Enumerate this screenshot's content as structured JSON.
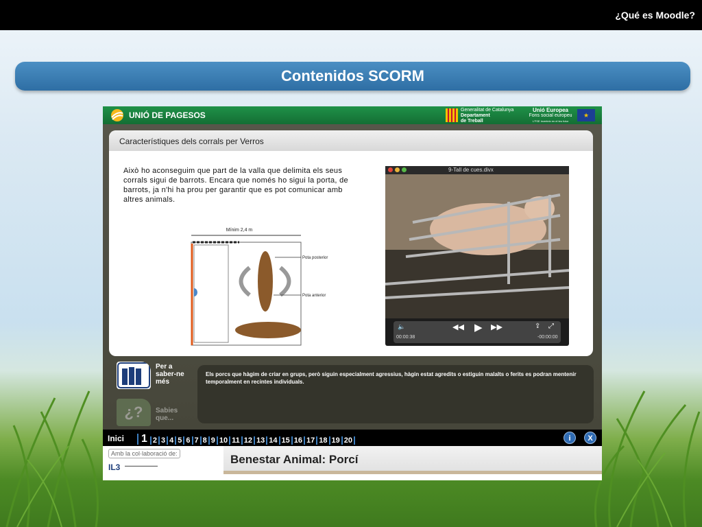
{
  "slide": {
    "header": "¿Qué es Moodle?",
    "banner": "Contenidos SCORM"
  },
  "app": {
    "brand": "UNIÓ DE PAGESOS",
    "partner_lines": [
      "Generalitat de Catalunya",
      "Departament",
      "de Treball"
    ],
    "eu_lines": [
      "Unió Europea",
      "Fons social europeu",
      "L'FSE inverteix en el teu futur"
    ],
    "card_title": "Característiques dels corrals per Verros",
    "card_text": "Això ho aconseguim que part de la valla que delimita els seus corrals sigui de barrots. Encara que només ho sigui la porta, de barrots, ja n'hi ha prou per garantir que es pot comunicar amb altres animals.",
    "diagram": {
      "width_label": "Mínim 2,4 m",
      "rear_leg_label": "Pota posterior",
      "front_leg_label": "Pota anterior"
    },
    "video": {
      "title": "9-Tall de cues.divx",
      "elapsed": "00:00:38",
      "remaining": "-00:00:00"
    },
    "side_buttons": [
      {
        "label": "Per a saber-ne més"
      },
      {
        "label": "Sabies que..."
      }
    ],
    "info_text": "Els porcs que hàgim de criar en grups, però siguin especialment agressius, hàgin estat agredits o estiguin malalts o ferits es podran mentenir temporalment en recintes individuals.",
    "nav": {
      "start": "Inici",
      "current": "1",
      "pages": [
        "2",
        "3",
        "4",
        "5",
        "6",
        "7",
        "8",
        "9",
        "10",
        "11",
        "12",
        "13",
        "14",
        "15",
        "16",
        "17",
        "18",
        "19",
        "20"
      ],
      "help_icon": "i",
      "close_icon": "X"
    },
    "footer": {
      "collab": "Amb la col·laboració de:",
      "logo": "IL3",
      "course_title": "Benestar Animal: Porcí"
    }
  },
  "colors": {
    "banner": "#2e6ea4",
    "app_header_green": "#1f9148",
    "nav_accent": "#3d7fc0"
  }
}
